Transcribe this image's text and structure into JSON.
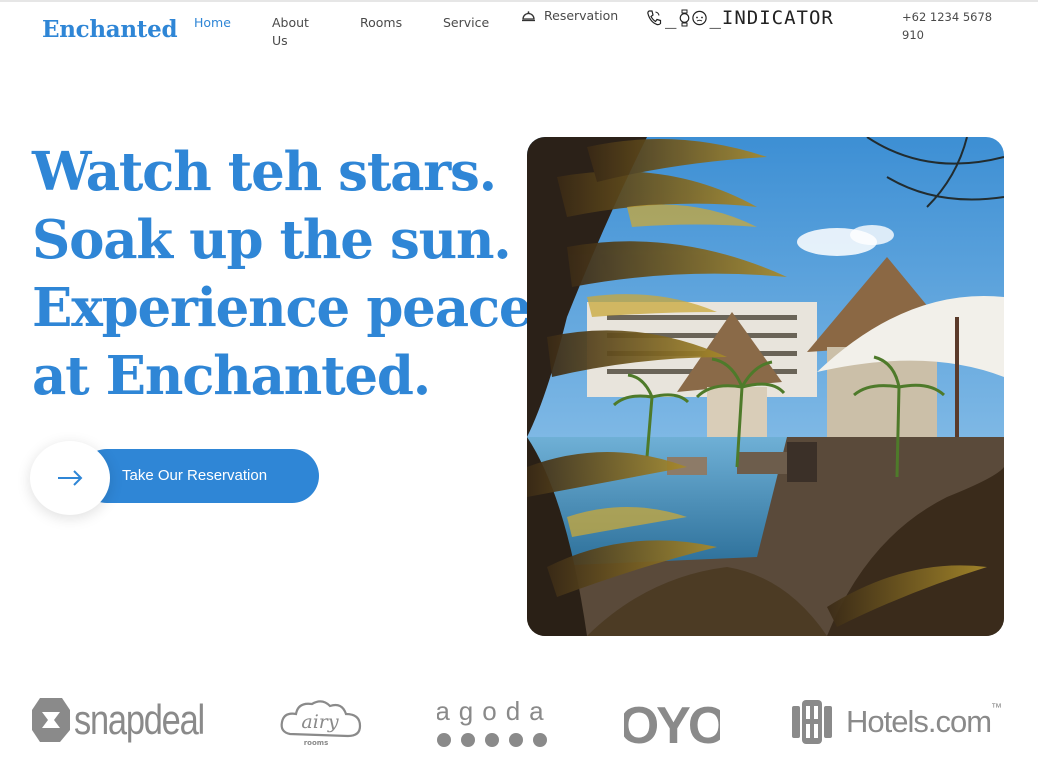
{
  "brand": {
    "name": "Enchanted"
  },
  "nav": {
    "items": [
      {
        "label": "Home",
        "active": true
      },
      {
        "label": "About Us"
      },
      {
        "label": "Rooms"
      },
      {
        "label": "Service"
      }
    ],
    "reservation_label": "Reservation",
    "indicator_label": "_INDICATOR",
    "phone": "+62 1234 5678 910"
  },
  "hero": {
    "title_lines": [
      "Watch teh stars.",
      "Soak up the sun.",
      "Experience peace",
      "at Enchanted."
    ],
    "cta_label": "Take Our Reservation"
  },
  "partners": {
    "snapdeal": "snapdeal",
    "airy": "airy",
    "airy_sub": "rooms",
    "agoda": "agoda",
    "oyo": "OYO",
    "hotels": "Hotels.com",
    "hotels_tm": "™"
  },
  "colors": {
    "accent": "#2f86d6",
    "logo_gray": "#8a8a8a"
  }
}
